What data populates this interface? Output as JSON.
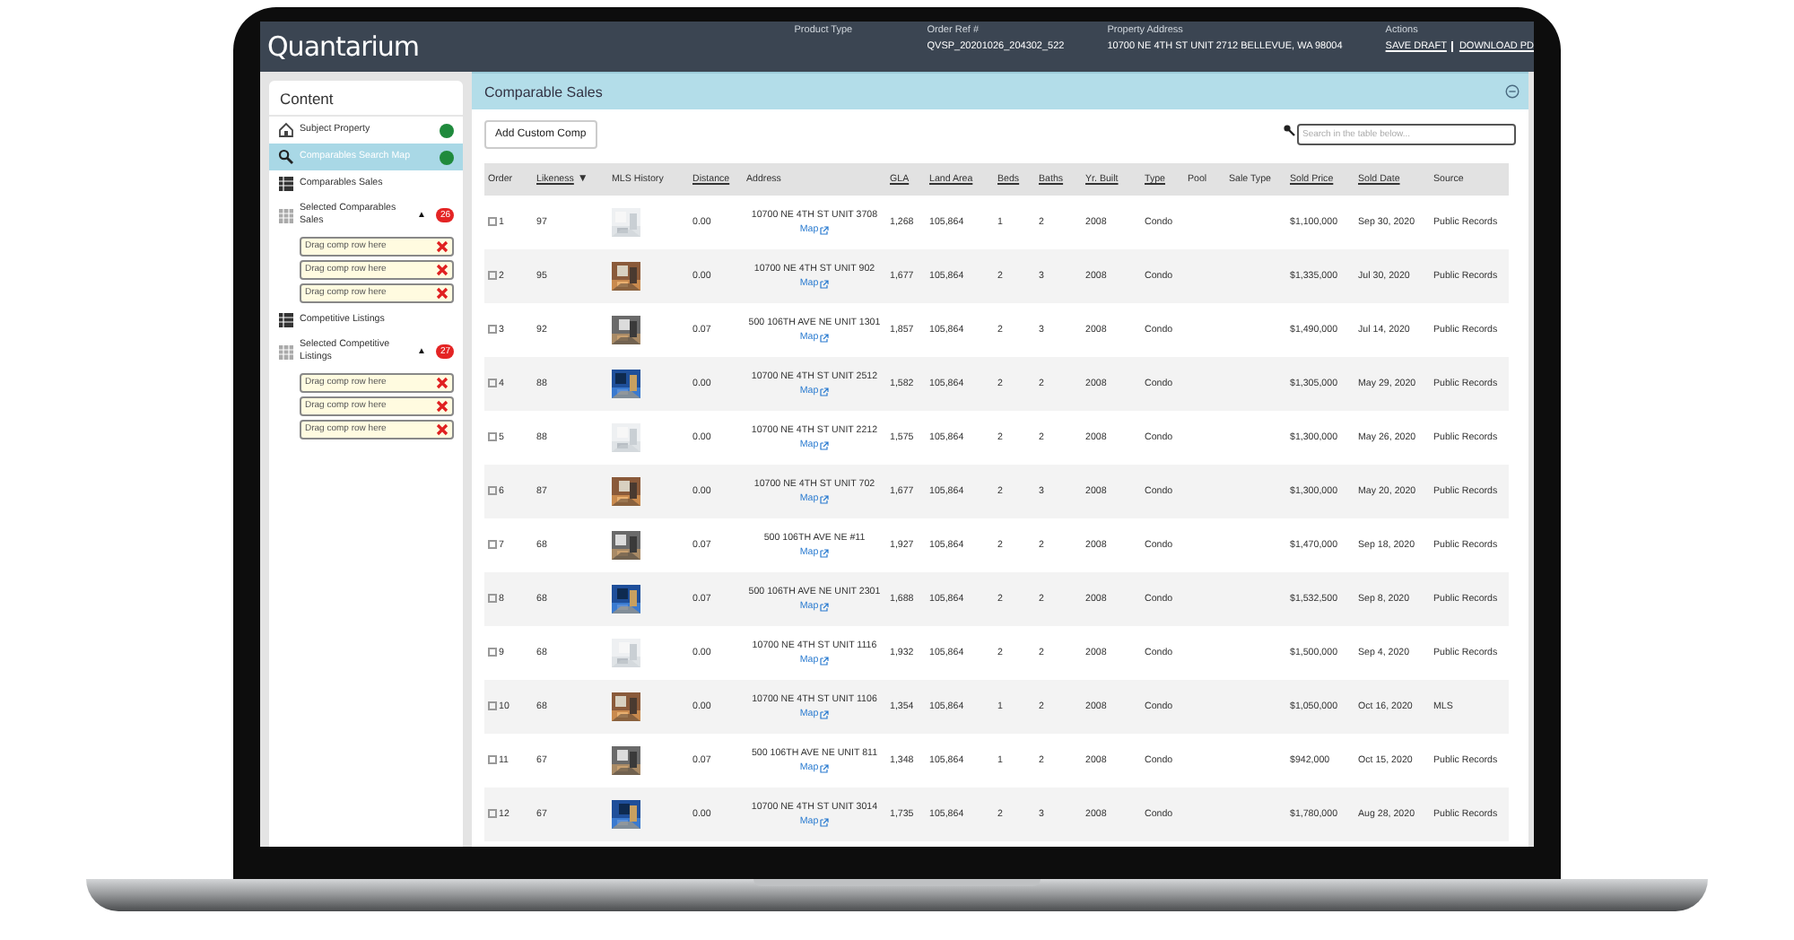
{
  "header": {
    "logo": "Quantarium",
    "fields": [
      {
        "label": "Product Type"
      },
      {
        "label": "Order Ref #",
        "value": "QVSP_20201026_204302_522"
      },
      {
        "label": "Property Address",
        "value": "10700 NE 4TH ST UNIT 2712 BELLEVUE, WA 98004"
      }
    ],
    "actions": {
      "label": "Actions",
      "links": [
        "SAVE DRAFT",
        "DOWNLOAD PD"
      ]
    }
  },
  "sidebar": {
    "title": "Content",
    "items": [
      {
        "kind": "property",
        "label": "Subject Property",
        "selected": false,
        "color": "#1f8a3c"
      },
      {
        "kind": "map",
        "label": "Comparables Search Map",
        "selected": true,
        "color": "#1f8a3c"
      },
      {
        "kind": "list",
        "label": "Comparables Sales",
        "selected": false
      },
      {
        "kind": "selection",
        "label": "Selected Comparables Sales",
        "selected": false,
        "toggle": "▲",
        "badge": "26",
        "slots": [
          "Drag comp row here",
          "Drag comp row here",
          "Drag comp row here"
        ]
      },
      {
        "kind": "list",
        "label": "Competitive Listings",
        "selected": false
      },
      {
        "kind": "selection",
        "label": "Selected Competitive Listings",
        "selected": false,
        "toggle": "▲",
        "badge": "27",
        "slots": [
          "Drag comp row here",
          "Drag comp row here",
          "Drag comp row here"
        ]
      }
    ]
  },
  "panel": {
    "title": "Comparable Sales",
    "add_button": "Add Custom Comp",
    "search": {
      "placeholder": "Search in the table below..."
    }
  },
  "table": {
    "columns": [
      {
        "label": "Order",
        "sortable": false
      },
      {
        "label": "Likeness",
        "sortable": true,
        "sort_indicator": "▼"
      },
      {
        "label": "MLS History",
        "sortable": false
      },
      {
        "label": "Distance",
        "sortable": true
      },
      {
        "label": "Address",
        "sortable": false
      },
      {
        "label": "GLA",
        "sortable": true
      },
      {
        "label": "Land Area",
        "sortable": true
      },
      {
        "label": "Beds",
        "sortable": true
      },
      {
        "label": "Baths",
        "sortable": true
      },
      {
        "label": "Yr. Built",
        "sortable": true
      },
      {
        "label": "Type",
        "sortable": true
      },
      {
        "label": "Pool",
        "sortable": false
      },
      {
        "label": "Sale Type",
        "sortable": false
      },
      {
        "label": "Sold Price",
        "sortable": true
      },
      {
        "label": "Sold Date",
        "sortable": true
      },
      {
        "label": "Source",
        "sortable": false
      }
    ],
    "rows": [
      {
        "checked": false,
        "cells": [
          {
            "text": "1"
          },
          {
            "text": "97"
          },
          {
            "kind": "picture"
          },
          {
            "text": "0.00"
          },
          {
            "text": "10700 NE 4TH ST UNIT 3708",
            "link": "Map"
          },
          {
            "text": "1,268"
          },
          {
            "text": "105,864"
          },
          {
            "text": "1"
          },
          {
            "text": "2"
          },
          {
            "text": "2008"
          },
          {
            "text": "Condo"
          },
          null,
          null,
          {
            "text": "$1,100,000"
          },
          {
            "text": "Sep 30, 2020"
          },
          {
            "text": "Public Records"
          }
        ]
      },
      {
        "checked": false,
        "cells": [
          {
            "text": "2"
          },
          {
            "text": "95"
          },
          {
            "kind": "picture"
          },
          {
            "text": "0.00"
          },
          {
            "text": "10700 NE 4TH ST UNIT 902",
            "link": "Map"
          },
          {
            "text": "1,677"
          },
          {
            "text": "105,864"
          },
          {
            "text": "2"
          },
          {
            "text": "3"
          },
          {
            "text": "2008"
          },
          {
            "text": "Condo"
          },
          null,
          null,
          {
            "text": "$1,335,000"
          },
          {
            "text": "Jul 30, 2020"
          },
          {
            "text": "Public Records"
          }
        ]
      },
      {
        "checked": false,
        "cells": [
          {
            "text": "3"
          },
          {
            "text": "92"
          },
          {
            "kind": "picture"
          },
          {
            "text": "0.07"
          },
          {
            "text": "500 106TH AVE NE UNIT 1301",
            "link": "Map"
          },
          {
            "text": "1,857"
          },
          {
            "text": "105,864"
          },
          {
            "text": "2"
          },
          {
            "text": "3"
          },
          {
            "text": "2008"
          },
          {
            "text": "Condo"
          },
          null,
          null,
          {
            "text": "$1,490,000"
          },
          {
            "text": "Jul 14, 2020"
          },
          {
            "text": "Public Records"
          }
        ]
      },
      {
        "checked": false,
        "cells": [
          {
            "text": "4"
          },
          {
            "text": "88"
          },
          {
            "kind": "picture"
          },
          {
            "text": "0.00"
          },
          {
            "text": "10700 NE 4TH ST UNIT 2512",
            "link": "Map"
          },
          {
            "text": "1,582"
          },
          {
            "text": "105,864"
          },
          {
            "text": "2"
          },
          {
            "text": "2"
          },
          {
            "text": "2008"
          },
          {
            "text": "Condo"
          },
          null,
          null,
          {
            "text": "$1,305,000"
          },
          {
            "text": "May 29, 2020"
          },
          {
            "text": "Public Records"
          }
        ]
      },
      {
        "checked": false,
        "cells": [
          {
            "text": "5"
          },
          {
            "text": "88"
          },
          {
            "kind": "picture"
          },
          {
            "text": "0.00"
          },
          {
            "text": "10700 NE 4TH ST UNIT 2212",
            "link": "Map"
          },
          {
            "text": "1,575"
          },
          {
            "text": "105,864"
          },
          {
            "text": "2"
          },
          {
            "text": "2"
          },
          {
            "text": "2008"
          },
          {
            "text": "Condo"
          },
          null,
          null,
          {
            "text": "$1,300,000"
          },
          {
            "text": "May 26, 2020"
          },
          {
            "text": "Public Records"
          }
        ]
      },
      {
        "checked": false,
        "cells": [
          {
            "text": "6"
          },
          {
            "text": "87"
          },
          {
            "kind": "picture"
          },
          {
            "text": "0.00"
          },
          {
            "text": "10700 NE 4TH ST UNIT 702",
            "link": "Map"
          },
          {
            "text": "1,677"
          },
          {
            "text": "105,864"
          },
          {
            "text": "2"
          },
          {
            "text": "3"
          },
          {
            "text": "2008"
          },
          {
            "text": "Condo"
          },
          null,
          null,
          {
            "text": "$1,300,000"
          },
          {
            "text": "May 20, 2020"
          },
          {
            "text": "Public Records"
          }
        ]
      },
      {
        "checked": false,
        "cells": [
          {
            "text": "7"
          },
          {
            "text": "68"
          },
          {
            "kind": "picture"
          },
          {
            "text": "0.07"
          },
          {
            "text": "500 106TH AVE NE #11",
            "link": "Map"
          },
          {
            "text": "1,927"
          },
          {
            "text": "105,864"
          },
          {
            "text": "2"
          },
          {
            "text": "2"
          },
          {
            "text": "2008"
          },
          {
            "text": "Condo"
          },
          null,
          null,
          {
            "text": "$1,470,000"
          },
          {
            "text": "Sep 18, 2020"
          },
          {
            "text": "Public Records"
          }
        ]
      },
      {
        "checked": false,
        "cells": [
          {
            "text": "8"
          },
          {
            "text": "68"
          },
          {
            "kind": "picture"
          },
          {
            "text": "0.07"
          },
          {
            "text": "500 106TH AVE NE UNIT 2301",
            "link": "Map"
          },
          {
            "text": "1,688"
          },
          {
            "text": "105,864"
          },
          {
            "text": "2"
          },
          {
            "text": "2"
          },
          {
            "text": "2008"
          },
          {
            "text": "Condo"
          },
          null,
          null,
          {
            "text": "$1,532,500"
          },
          {
            "text": "Sep 8, 2020"
          },
          {
            "text": "Public Records"
          }
        ]
      },
      {
        "checked": false,
        "cells": [
          {
            "text": "9"
          },
          {
            "text": "68"
          },
          {
            "kind": "picture"
          },
          {
            "text": "0.00"
          },
          {
            "text": "10700 NE 4TH ST UNIT 1116",
            "link": "Map"
          },
          {
            "text": "1,932"
          },
          {
            "text": "105,864"
          },
          {
            "text": "2"
          },
          {
            "text": "2"
          },
          {
            "text": "2008"
          },
          {
            "text": "Condo"
          },
          null,
          null,
          {
            "text": "$1,500,000"
          },
          {
            "text": "Sep 4, 2020"
          },
          {
            "text": "Public Records"
          }
        ]
      },
      {
        "checked": false,
        "cells": [
          {
            "text": "10"
          },
          {
            "text": "68"
          },
          {
            "kind": "picture"
          },
          {
            "text": "0.00"
          },
          {
            "text": "10700 NE 4TH ST UNIT 1106",
            "link": "Map"
          },
          {
            "text": "1,354"
          },
          {
            "text": "105,864"
          },
          {
            "text": "1"
          },
          {
            "text": "2"
          },
          {
            "text": "2008"
          },
          {
            "text": "Condo"
          },
          null,
          null,
          {
            "text": "$1,050,000"
          },
          {
            "text": "Oct 16, 2020"
          },
          {
            "text": "MLS"
          }
        ]
      },
      {
        "checked": false,
        "cells": [
          {
            "text": "11"
          },
          {
            "text": "67"
          },
          {
            "kind": "picture"
          },
          {
            "text": "0.07"
          },
          {
            "text": "500 106TH AVE NE UNIT 811",
            "link": "Map"
          },
          {
            "text": "1,348"
          },
          {
            "text": "105,864"
          },
          {
            "text": "1"
          },
          {
            "text": "2"
          },
          {
            "text": "2008"
          },
          {
            "text": "Condo"
          },
          null,
          null,
          {
            "text": "$942,000"
          },
          {
            "text": "Oct 15, 2020"
          },
          {
            "text": "Public Records"
          }
        ]
      },
      {
        "checked": false,
        "cells": [
          {
            "text": "12"
          },
          {
            "text": "67"
          },
          {
            "kind": "picture"
          },
          {
            "text": "0.00"
          },
          {
            "text": "10700 NE 4TH ST UNIT 3014",
            "link": "Map"
          },
          {
            "text": "1,735"
          },
          {
            "text": "105,864"
          },
          {
            "text": "2"
          },
          {
            "text": "3"
          },
          {
            "text": "2008"
          },
          {
            "text": "Condo"
          },
          null,
          null,
          {
            "text": "$1,780,000"
          },
          {
            "text": "Aug 28, 2020"
          },
          {
            "text": "Public Records"
          }
        ]
      }
    ]
  }
}
